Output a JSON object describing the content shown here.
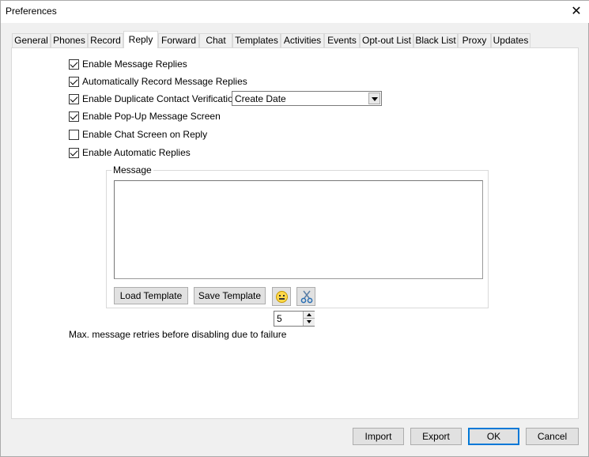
{
  "window": {
    "title": "Preferences",
    "close_glyph": "✕"
  },
  "tabs": [
    {
      "label": "General"
    },
    {
      "label": "Phones"
    },
    {
      "label": "Record"
    },
    {
      "label": "Reply"
    },
    {
      "label": "Forward"
    },
    {
      "label": "Chat"
    },
    {
      "label": "Templates"
    },
    {
      "label": "Activities"
    },
    {
      "label": "Events"
    },
    {
      "label": "Opt-out List"
    },
    {
      "label": "Black List"
    },
    {
      "label": "Proxy"
    },
    {
      "label": "Updates"
    }
  ],
  "active_tab": "Reply",
  "options": [
    {
      "label": "Enable Message Replies",
      "checked": true
    },
    {
      "label": "Automatically Record Message Replies",
      "checked": true
    },
    {
      "label": "Enable Duplicate Contact Verification",
      "checked": true
    },
    {
      "label": "Enable Pop-Up Message Screen",
      "checked": true
    },
    {
      "label": "Enable Chat Screen on Reply",
      "checked": false
    },
    {
      "label": "Enable Automatic Replies",
      "checked": true
    }
  ],
  "duplicate_select": {
    "value": "Create Date"
  },
  "message_group": {
    "label": "Message",
    "text": "",
    "load_template": "Load Template",
    "save_template": "Save Template"
  },
  "retries": {
    "value": "5",
    "label": "Max. message retries before disabling due to failure"
  },
  "footer": {
    "import": "Import",
    "export": "Export",
    "ok": "OK",
    "cancel": "Cancel"
  }
}
